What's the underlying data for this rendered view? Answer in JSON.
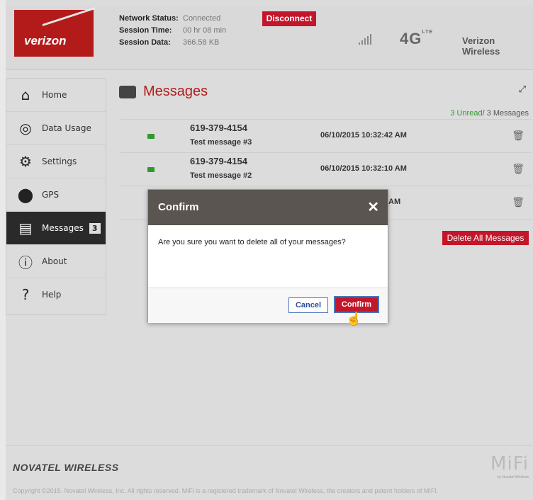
{
  "header": {
    "logo_text": "verizon",
    "network_status_label": "Network Status:",
    "network_status_value": "Connected",
    "session_time_label": "Session Time:",
    "session_time_value": "00 hr 08 min",
    "session_data_label": "Session Data:",
    "session_data_value": "366.58 KB",
    "disconnect_label": "Disconnect",
    "network_type": "4G",
    "network_sub": "LTE",
    "carrier": "Verizon Wireless"
  },
  "sidebar": {
    "items": [
      {
        "label": "Home",
        "icon": "home-icon"
      },
      {
        "label": "Data Usage",
        "icon": "data-usage-icon"
      },
      {
        "label": "Settings",
        "icon": "settings-gears-icon"
      },
      {
        "label": "GPS",
        "icon": "gps-pin-icon"
      },
      {
        "label": "Messages",
        "icon": "message-icon",
        "badge": "3",
        "active": true
      },
      {
        "label": "About",
        "icon": "info-icon"
      },
      {
        "label": "Help",
        "icon": "help-icon"
      }
    ]
  },
  "main": {
    "title": "Messages",
    "unread_count": "3 Unread",
    "total_count": "/ 3 Messages",
    "messages": [
      {
        "number": "619-379-4154",
        "text": "Test message #3",
        "date": "06/10/2015 10:32:42 AM"
      },
      {
        "number": "619-379-4154",
        "text": "Test message #2",
        "date": "06/10/2015 10:32:10 AM"
      },
      {
        "number": "",
        "text": "",
        "date": "AM"
      }
    ],
    "delete_all_label": "Delete All Messages"
  },
  "modal": {
    "title": "Confirm",
    "body": "Are you sure you want to delete all of your messages?",
    "cancel_label": "Cancel",
    "confirm_label": "Confirm"
  },
  "footer": {
    "brand": "NOVATEL WIRELESS",
    "product": "MiFi",
    "product_sub": "by Novatel Wireless",
    "copyright": "Copyright ©2015. Novatel Wireless, Inc. All rights reserved. MiFi is a registered trademark of Novatel Wireless, the creators and patent holders of MIFI."
  }
}
